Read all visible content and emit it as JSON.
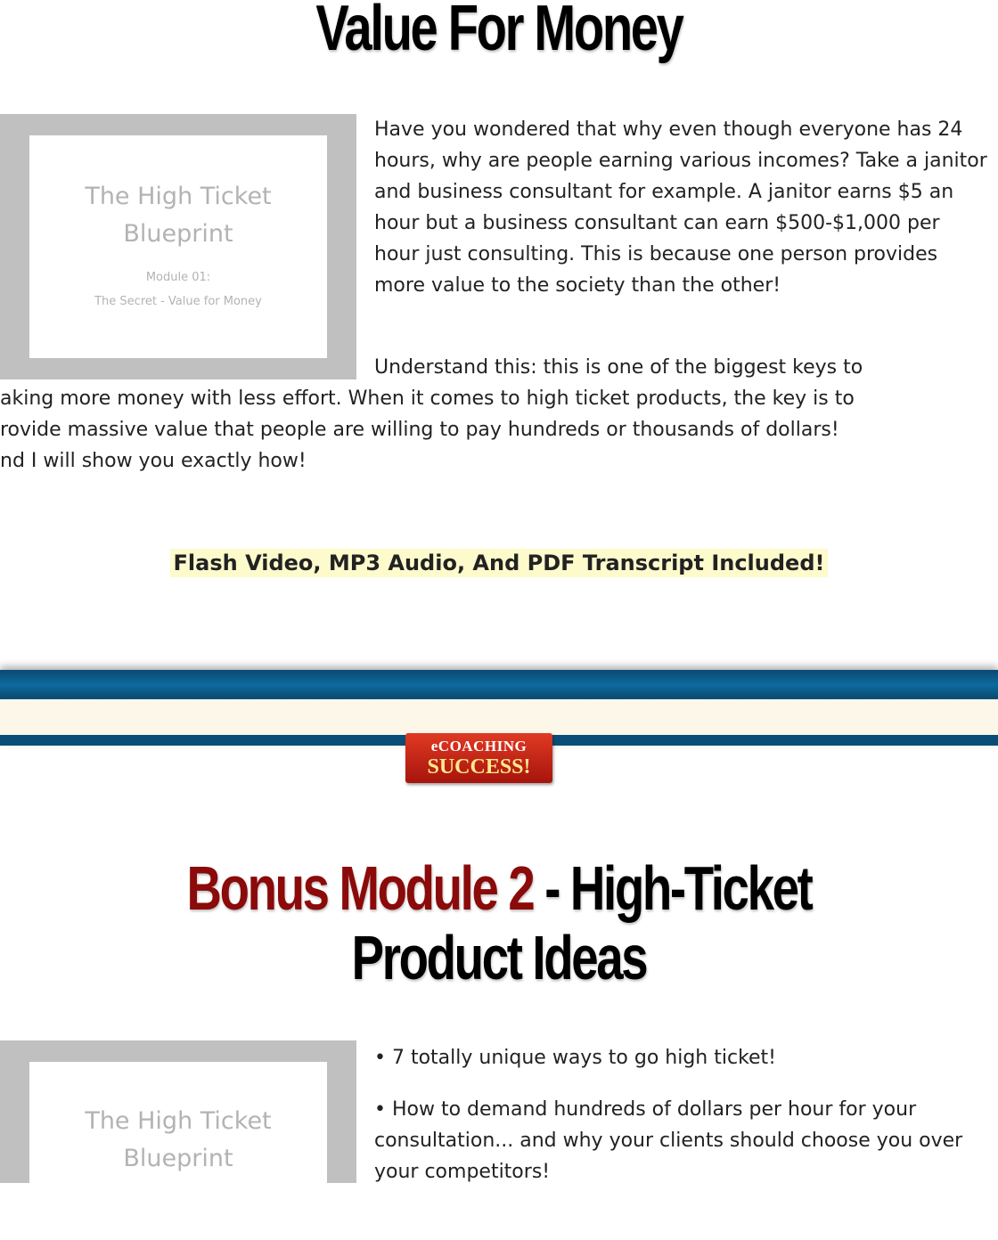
{
  "section1": {
    "heading": "Value For Money",
    "cover": {
      "title_line1": "The High Ticket",
      "title_line2": "Blueprint",
      "module": "Module 01:",
      "subtitle": "The Secret - Value for Money"
    },
    "paragraph1": "Have you wondered that why even though everyone has 24 hours, why are people earning various incomes? Take a janitor and business consultant for example. A janitor earns $5 an hour but a business consultant can earn $500-$1,000 per hour just consulting. This is because one person provides more value to the society than the other!",
    "paragraph2_line1": "Understand this: this is one of the biggest keys to",
    "paragraph2_line2": "aking more money with less effort. When it comes to high ticket products, the key is to",
    "paragraph2_line3": "rovide massive value that people are willing to pay hundreds or thousands of dollars!",
    "paragraph2_line4": "nd I will show you exactly how!",
    "included": "Flash Video, MP3 Audio, And PDF Transcript Included!"
  },
  "logo": {
    "line1": "eCOACHING",
    "line2": "SUCCESS!"
  },
  "section2": {
    "heading_red": "Bonus Module 2",
    "heading_black_line1": " - High-Ticket",
    "heading_black_line2": "Product Ideas",
    "cover": {
      "title_line1": "The High Ticket",
      "title_line2": "Blueprint"
    },
    "bullets": [
      "• 7 totally unique ways to go high ticket!",
      "• How to demand hundreds of dollars per hour for your consultation... and why your clients should choose you over your competitors!"
    ]
  },
  "colors": {
    "heading_red": "#8b0a0a",
    "bar_blue": "#0d6a9e",
    "highlight": "#fdfacc",
    "logo_red": "#c0281a"
  }
}
